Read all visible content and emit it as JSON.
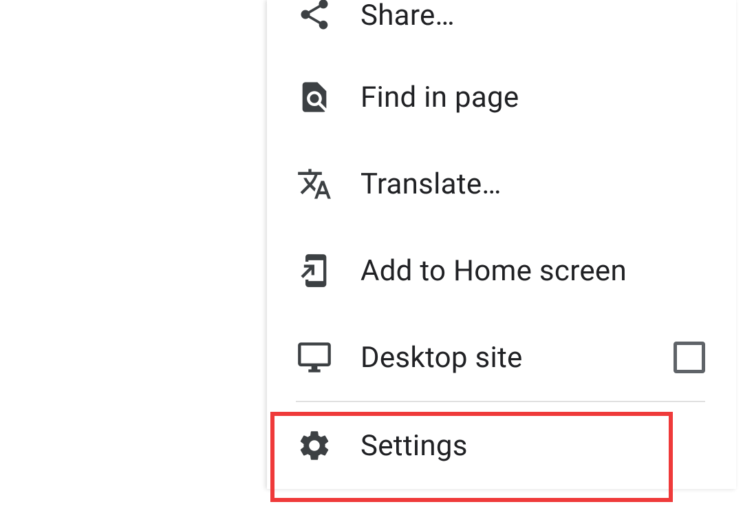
{
  "menu": {
    "items": [
      {
        "id": "share",
        "label": "Share…"
      },
      {
        "id": "find",
        "label": "Find in page"
      },
      {
        "id": "translate",
        "label": "Translate…"
      },
      {
        "id": "addhome",
        "label": "Add to Home screen"
      },
      {
        "id": "desktop",
        "label": "Desktop site"
      },
      {
        "id": "settings",
        "label": "Settings"
      }
    ]
  }
}
